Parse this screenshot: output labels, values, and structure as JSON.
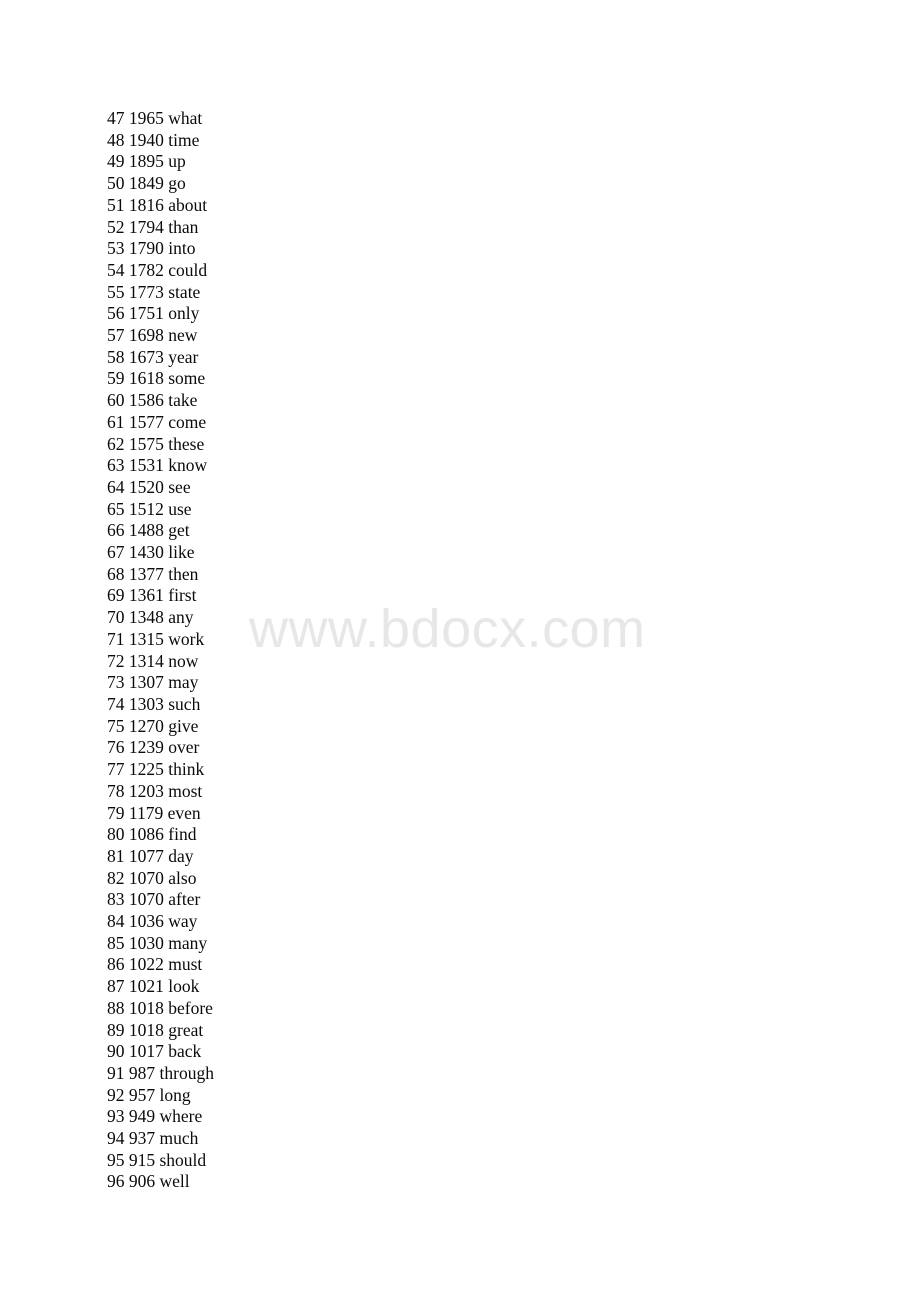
{
  "document": {
    "type": "word-frequency-list",
    "columns": [
      "rank",
      "count",
      "word"
    ],
    "separator": " ",
    "rows": [
      {
        "rank": "47",
        "count": "1965",
        "word": "what"
      },
      {
        "rank": "48",
        "count": "1940",
        "word": "time"
      },
      {
        "rank": "49",
        "count": "1895",
        "word": "up"
      },
      {
        "rank": "50",
        "count": "1849",
        "word": "go"
      },
      {
        "rank": "51",
        "count": "1816",
        "word": "about"
      },
      {
        "rank": "52",
        "count": "1794",
        "word": "than"
      },
      {
        "rank": "53",
        "count": "1790",
        "word": "into"
      },
      {
        "rank": "54",
        "count": "1782",
        "word": "could"
      },
      {
        "rank": "55",
        "count": "1773",
        "word": "state"
      },
      {
        "rank": "56",
        "count": "1751",
        "word": "only"
      },
      {
        "rank": "57",
        "count": "1698",
        "word": "new"
      },
      {
        "rank": "58",
        "count": "1673",
        "word": "year"
      },
      {
        "rank": "59",
        "count": "1618",
        "word": "some"
      },
      {
        "rank": "60",
        "count": "1586",
        "word": "take"
      },
      {
        "rank": "61",
        "count": "1577",
        "word": "come"
      },
      {
        "rank": "62",
        "count": "1575",
        "word": "these"
      },
      {
        "rank": "63",
        "count": "1531",
        "word": "know"
      },
      {
        "rank": "64",
        "count": "1520",
        "word": "see"
      },
      {
        "rank": "65",
        "count": "1512",
        "word": "use"
      },
      {
        "rank": "66",
        "count": "1488",
        "word": "get"
      },
      {
        "rank": "67",
        "count": "1430",
        "word": "like"
      },
      {
        "rank": "68",
        "count": "1377",
        "word": "then"
      },
      {
        "rank": "69",
        "count": "1361",
        "word": "first"
      },
      {
        "rank": "70",
        "count": "1348",
        "word": "any"
      },
      {
        "rank": "71",
        "count": "1315",
        "word": "work"
      },
      {
        "rank": "72",
        "count": "1314",
        "word": "now"
      },
      {
        "rank": "73",
        "count": "1307",
        "word": "may"
      },
      {
        "rank": "74",
        "count": "1303",
        "word": "such"
      },
      {
        "rank": "75",
        "count": "1270",
        "word": "give"
      },
      {
        "rank": "76",
        "count": "1239",
        "word": "over"
      },
      {
        "rank": "77",
        "count": "1225",
        "word": "think"
      },
      {
        "rank": "78",
        "count": "1203",
        "word": "most"
      },
      {
        "rank": "79",
        "count": "1179",
        "word": "even"
      },
      {
        "rank": "80",
        "count": "1086",
        "word": "find"
      },
      {
        "rank": "81",
        "count": "1077",
        "word": "day"
      },
      {
        "rank": "82",
        "count": "1070",
        "word": "also"
      },
      {
        "rank": "83",
        "count": "1070",
        "word": "after"
      },
      {
        "rank": "84",
        "count": "1036",
        "word": "way"
      },
      {
        "rank": "85",
        "count": "1030",
        "word": "many"
      },
      {
        "rank": "86",
        "count": "1022",
        "word": "must"
      },
      {
        "rank": "87",
        "count": "1021",
        "word": "look"
      },
      {
        "rank": "88",
        "count": "1018",
        "word": "before"
      },
      {
        "rank": "89",
        "count": "1018",
        "word": "great"
      },
      {
        "rank": "90",
        "count": "1017",
        "word": "back"
      },
      {
        "rank": "91",
        "count": "987",
        "word": "through"
      },
      {
        "rank": "92",
        "count": "957",
        "word": "long"
      },
      {
        "rank": "93",
        "count": "949",
        "word": "where"
      },
      {
        "rank": "94",
        "count": "937",
        "word": "much"
      },
      {
        "rank": "95",
        "count": "915",
        "word": "should"
      },
      {
        "rank": "96",
        "count": "906",
        "word": "well"
      }
    ]
  },
  "watermark": {
    "text": "www.bdocx.com",
    "color": "#e7e7e7"
  },
  "page": {
    "background_color": "#ffffff",
    "text_color": "#0b0b0b"
  }
}
